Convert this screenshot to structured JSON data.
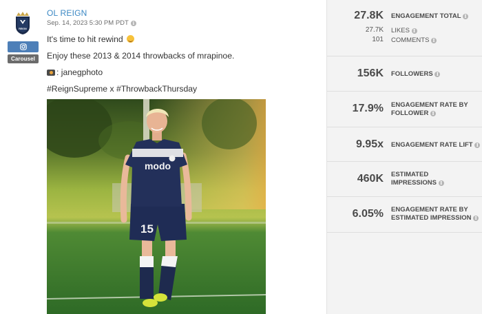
{
  "post": {
    "author": "OL REIGN",
    "avatar_text": "REIGN",
    "platform_icon": "instagram-icon",
    "type_badge": "Carousel",
    "timestamp": "Sep. 14, 2023 5:30 PM PDT",
    "caption": {
      "line1": "It's time to hit rewind",
      "line2": "Enjoy these 2013 & 2014 throwbacks of mrapinoe.",
      "line3": "janegphoto",
      "line4": "#ReignSupreme x #ThrowbackThursday"
    },
    "photo": {
      "jersey_sponsor": "modo",
      "jersey_number": "15"
    }
  },
  "metrics": {
    "engagement_total": {
      "value": "27.8K",
      "label": "ENGAGEMENT TOTAL"
    },
    "likes": {
      "value": "27.7K",
      "label": "LIKES"
    },
    "comments": {
      "value": "101",
      "label": "COMMENTS"
    },
    "followers": {
      "value": "156K",
      "label": "FOLLOWERS"
    },
    "engagement_rate_by_follower": {
      "value": "17.9%",
      "label_l1": "ENGAGEMENT RATE BY",
      "label_l2": "FOLLOWER"
    },
    "engagement_rate_lift": {
      "value": "9.95x",
      "label": "ENGAGEMENT RATE LIFT"
    },
    "estimated_impressions": {
      "value": "460K",
      "label_l1": "ESTIMATED",
      "label_l2": "IMPRESSIONS"
    },
    "engagement_rate_by_impression": {
      "value": "6.05%",
      "label_l1": "ENGAGEMENT RATE BY",
      "label_l2": "ESTIMATED IMPRESSION"
    }
  },
  "colors": {
    "author_link": "#3b88c4",
    "instagram_badge": "#4d7fb8",
    "carousel_badge": "#6b6b6b",
    "metrics_panel": "#f3f3f3"
  }
}
